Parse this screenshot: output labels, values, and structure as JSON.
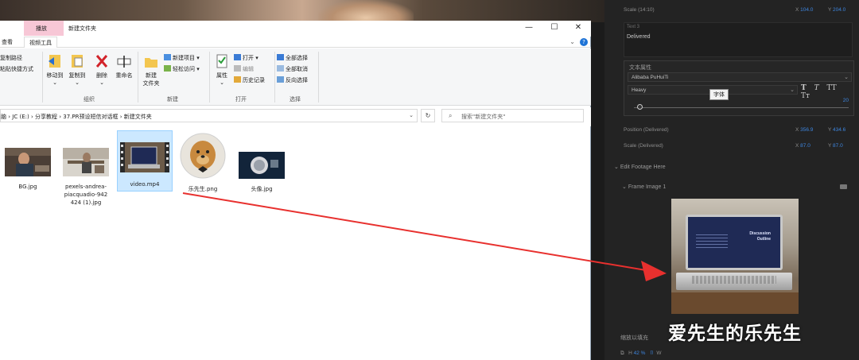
{
  "explorer": {
    "context_tab": "播放",
    "window_title": "新建文件夹",
    "window_buttons": {
      "minimize": "—",
      "maximize": "☐",
      "close": "✕"
    },
    "ribbon_tabs": {
      "view": "查看",
      "video_tools": "视频工具"
    },
    "clipboard": {
      "copy_path": "复制路径",
      "paste_shortcut": "粘贴快捷方式"
    },
    "organize": {
      "move_to": "移动到",
      "copy_to": "复制到",
      "delete": "删除",
      "rename": "重命名",
      "label": "组织"
    },
    "new": {
      "new_folder_line1": "新建",
      "new_folder_line2": "文件夹",
      "new_item": "新建项目",
      "easy_access": "轻松访问",
      "label": "新建"
    },
    "open": {
      "properties": "属性",
      "open": "打开",
      "edit": "编辑",
      "history": "历史记录",
      "label": "打开"
    },
    "select": {
      "select_all": "全部选择",
      "select_none": "全部取消",
      "invert": "反向选择",
      "label": "选择"
    },
    "address": {
      "segments": [
        "脑",
        "JC (E:)",
        "分享教程",
        "37.PR预设短信对话框",
        "新建文件夹"
      ],
      "separator": "›"
    },
    "search_placeholder": "搜索\"新建文件夹\"",
    "files": [
      {
        "name": "BG.jpg"
      },
      {
        "name": "pexels-andrea-piacquadio-942424 (1).jpg",
        "lines": [
          "pexels-andrea-",
          "piacquadio-942",
          "424 (1).jpg"
        ]
      },
      {
        "name": "video.mp4"
      },
      {
        "name": "乐先生.png"
      },
      {
        "name": "头像.jpg"
      }
    ]
  },
  "premiere": {
    "scale_label": "Scale (14:10)",
    "scale_x": "104.0",
    "scale_y": "204.0",
    "text_label": "Text 3",
    "text_value": "Delivered",
    "text_props_title": "文本属性",
    "font_family": "Alibaba PuHuiTi",
    "font_weight": "Heavy",
    "text_style_buttons": [
      "T",
      "T",
      "TT",
      "Tт"
    ],
    "tooltip": "字体",
    "font_size": "20",
    "position_label": "Position (Delivered)",
    "position_x": "356.9",
    "position_y": "434.6",
    "scale2_label": "Scale (Delivered)",
    "scale2_x": "87.0",
    "scale2_y": "87.0",
    "edit_section": "Edit Footage Here",
    "frame_label": "Frame Image 1",
    "screen_text_1": "Discussion",
    "screen_text_2": "Outline",
    "fill_label": "缩放以填充",
    "h_value": "42",
    "xy_letters": {
      "x": "X",
      "y": "Y"
    },
    "bottom_letters": {
      "h": "H",
      "w": "W"
    }
  },
  "watermark": "爱先生的乐先生",
  "colors": {
    "accent_blue": "#3d86e0",
    "arrow_red": "#e8302e",
    "selection_bg": "#cce8ff"
  }
}
